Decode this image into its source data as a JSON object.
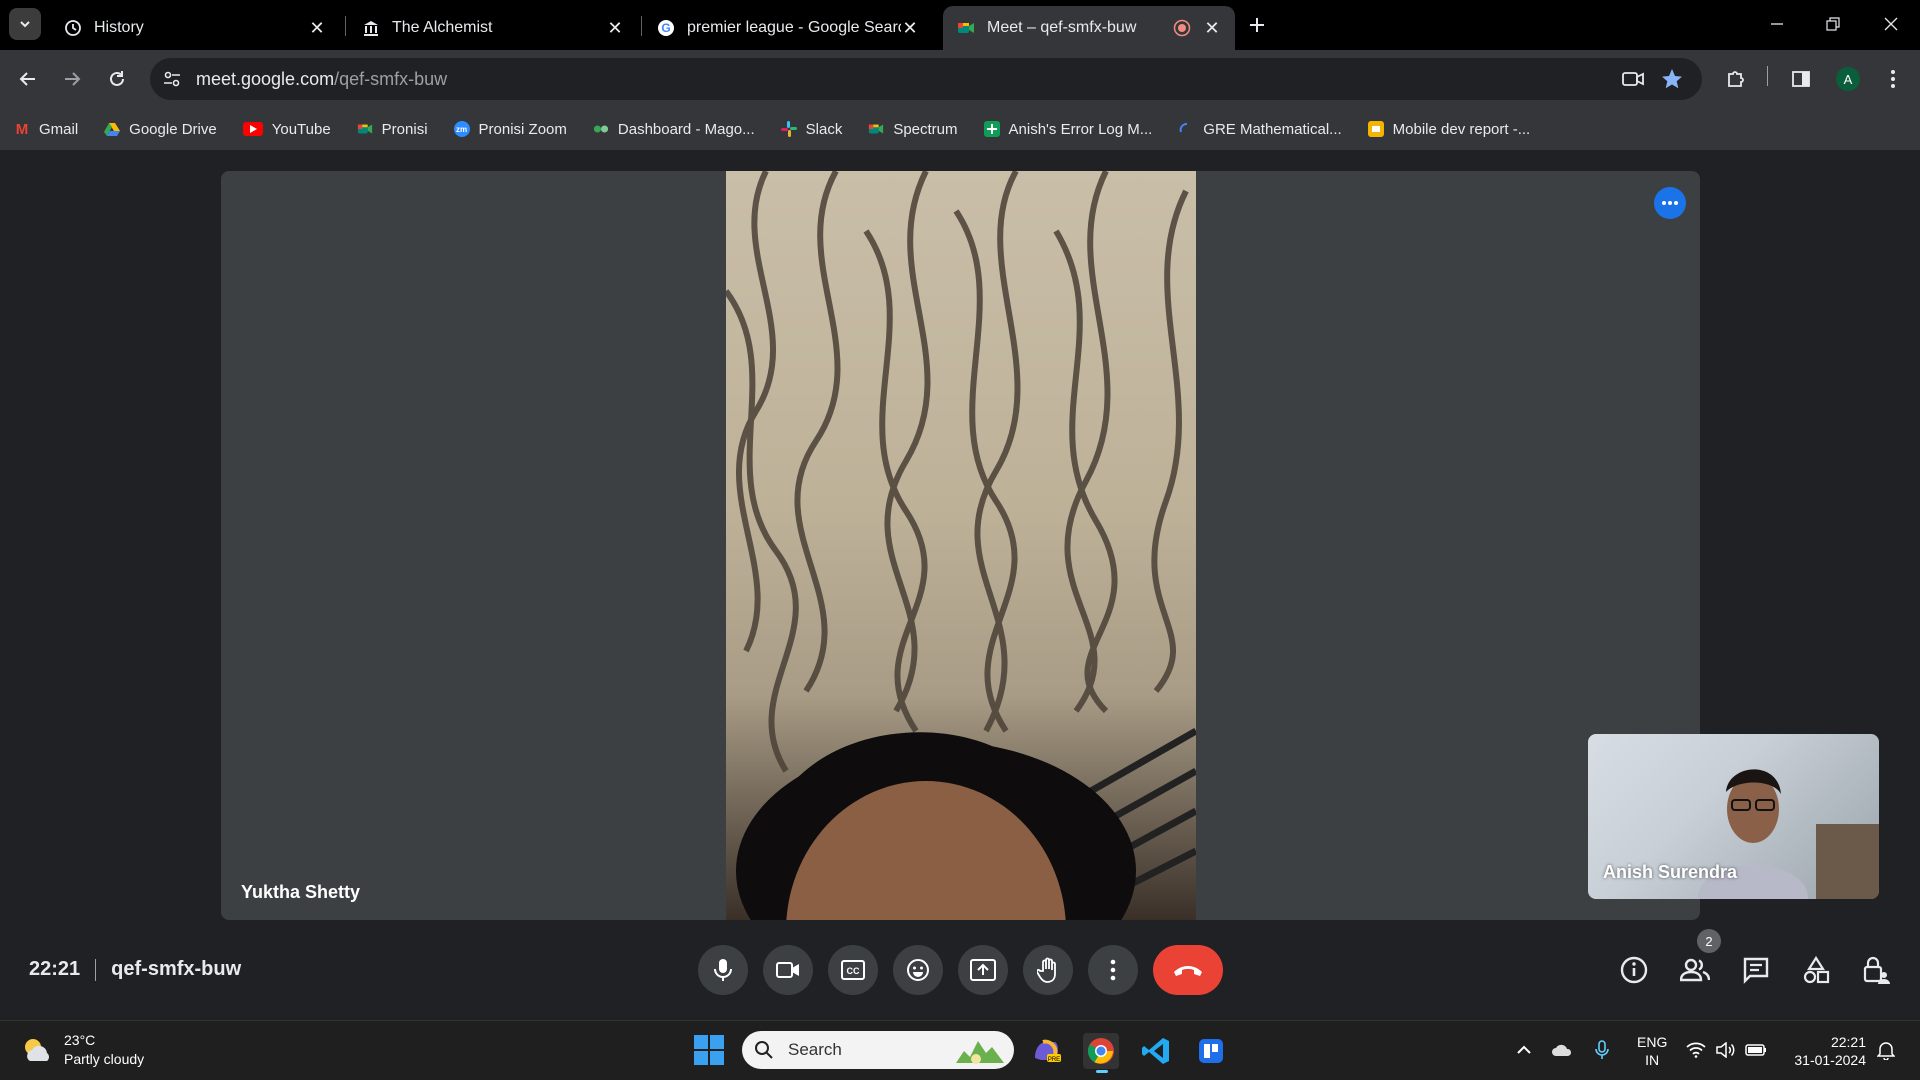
{
  "tabs": [
    {
      "title": "History",
      "icon": "history-icon"
    },
    {
      "title": "The Alchemist",
      "icon": "museum-icon"
    },
    {
      "title": "premier league - Google Search",
      "icon": "google-icon"
    },
    {
      "title": "Meet – qef-smfx-buw",
      "icon": "meet-icon",
      "active": true
    }
  ],
  "address_bar": {
    "host": "meet.google.com",
    "path": "/qef-smfx-buw"
  },
  "profile_initial": "A",
  "bookmarks": [
    {
      "label": "Gmail",
      "icon": "gmail-icon",
      "color": "#ea4335"
    },
    {
      "label": "Google Drive",
      "icon": "drive-icon",
      "color": "#34a853"
    },
    {
      "label": "YouTube",
      "icon": "youtube-icon",
      "color": "#ff0000"
    },
    {
      "label": "Pronisi",
      "icon": "meet-icon",
      "color": "#00897b"
    },
    {
      "label": "Pronisi Zoom",
      "icon": "zoom-icon",
      "color": "#2d8cff"
    },
    {
      "label": "Dashboard - Mago...",
      "icon": "dashboard-icon",
      "color": "#34a853"
    },
    {
      "label": "Slack",
      "icon": "slack-icon",
      "color": "#e01e5a"
    },
    {
      "label": "Spectrum",
      "icon": "meet-icon",
      "color": "#00897b"
    },
    {
      "label": "Anish's Error Log M...",
      "icon": "sheets-icon",
      "color": "#0f9d58"
    },
    {
      "label": "GRE Mathematical...",
      "icon": "loading-icon",
      "color": "#4285f4"
    },
    {
      "label": "Mobile dev report -...",
      "icon": "slides-icon",
      "color": "#f4b400"
    }
  ],
  "meeting": {
    "main_participant": "Yuktha Shetty",
    "self_participant": "Anish Surendra",
    "time": "22:21",
    "code": "qef-smfx-buw",
    "people_count": "2"
  },
  "taskbar": {
    "weather_temp": "23°C",
    "weather_desc": "Partly cloudy",
    "search_placeholder": "Search",
    "lang_line1": "ENG",
    "lang_line2": "IN",
    "clock_time": "22:21",
    "clock_date": "31-01-2024"
  },
  "colors": {
    "accent": "#1a73e8",
    "end_call": "#ea4335",
    "tile_bg": "#3c4043"
  }
}
